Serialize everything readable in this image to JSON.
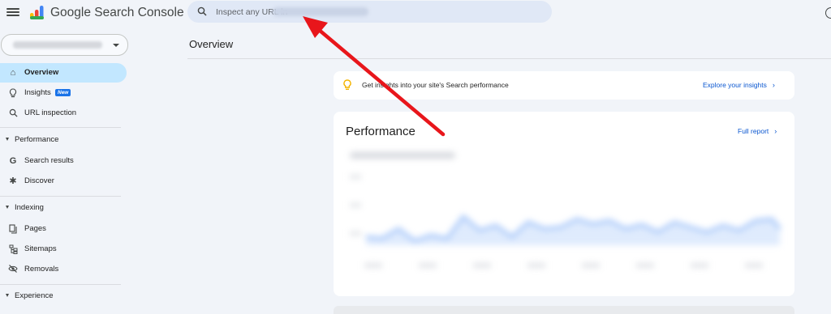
{
  "app": {
    "brand_google": "Google",
    "brand_product": "Search Console"
  },
  "search": {
    "placeholder": "Inspect any URL in"
  },
  "sidebar": {
    "items": [
      {
        "label": "Overview",
        "icon": "home-icon"
      },
      {
        "label": "Insights",
        "badge": "New",
        "icon": "lightbulb-icon"
      },
      {
        "label": "URL inspection",
        "icon": "search-icon"
      }
    ],
    "sections": [
      {
        "label": "Performance",
        "items": [
          {
            "label": "Search results",
            "icon": "google-g-icon"
          },
          {
            "label": "Discover",
            "icon": "asterisk-icon"
          }
        ]
      },
      {
        "label": "Indexing",
        "items": [
          {
            "label": "Pages",
            "icon": "pages-icon"
          },
          {
            "label": "Sitemaps",
            "icon": "sitemap-icon"
          },
          {
            "label": "Removals",
            "icon": "eye-off-icon"
          }
        ]
      },
      {
        "label": "Experience",
        "items": []
      }
    ]
  },
  "main": {
    "title": "Overview",
    "insight_text": "Get insights into your site's Search performance",
    "insight_link": "Explore your insights",
    "performance_title": "Performance",
    "performance_link": "Full report"
  },
  "colors": {
    "accent": "#0b57d0",
    "active_nav": "#c2e7ff",
    "annotation_arrow": "#e8161b"
  }
}
